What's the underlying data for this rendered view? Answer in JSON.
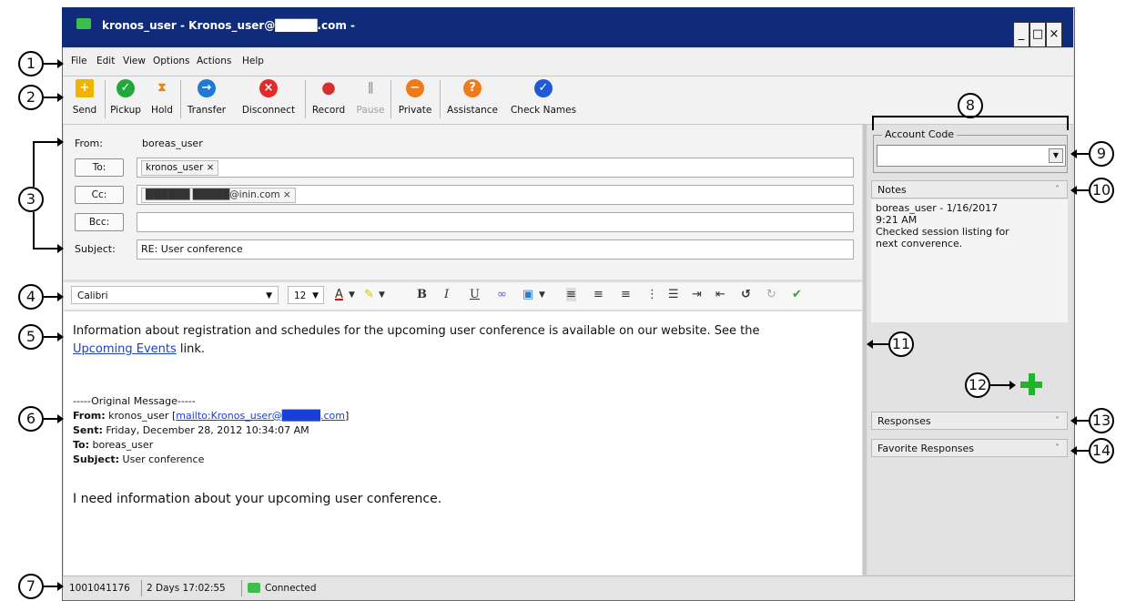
{
  "window": {
    "title": "kronos_user - Kronos_user@█████.com -",
    "min": "_",
    "max": "□",
    "close": "×"
  },
  "menu": [
    "File",
    "Edit",
    "View",
    "Options",
    "Actions",
    "Help"
  ],
  "toolbar": [
    {
      "label": "Send",
      "icon": "send-icon",
      "color": "#f0b400",
      "glyph": "+"
    },
    {
      "label": "Pickup",
      "icon": "pickup-icon",
      "color": "#22a83a",
      "glyph": "✓"
    },
    {
      "label": "Hold",
      "icon": "hold-icon",
      "color": "#e0891a",
      "glyph": "⧗"
    },
    {
      "label": "Transfer",
      "icon": "transfer-icon",
      "color": "#1f7ad6",
      "glyph": "→"
    },
    {
      "label": "Disconnect",
      "icon": "disconnect-icon",
      "color": "#e02b2b",
      "glyph": "×"
    },
    {
      "label": "Record",
      "icon": "record-icon",
      "color": "#d43030",
      "glyph": "●"
    },
    {
      "label": "Pause",
      "icon": "pause-icon",
      "color": "#9a9a9a",
      "glyph": "∥"
    },
    {
      "label": "Private",
      "icon": "private-icon",
      "color": "#ee7a1a",
      "glyph": "−"
    },
    {
      "label": "Assistance",
      "icon": "assistance-icon",
      "color": "#ee7a1a",
      "glyph": "?"
    },
    {
      "label": "Check Names",
      "icon": "check-names-icon",
      "color": "#1f5ad6",
      "glyph": "✓"
    }
  ],
  "header": {
    "from_label": "From:",
    "from_value": "boreas_user",
    "to_button": "To:",
    "to_chip": "kronos_user ×",
    "cc_button": "Cc:",
    "cc_chip": "██████ █████@inin.com ×",
    "bcc_button": "Bcc:",
    "subject_label": "Subject:",
    "subject_value": "RE: User conference"
  },
  "format": {
    "font": "Calibri",
    "size": "12"
  },
  "body": {
    "line1": "Information about registration and schedules for the upcoming user conference is available on our website.  See the",
    "link_text": "Upcoming Events",
    "line2_rest": " link.",
    "orig_header": "-----Original Message-----",
    "from_label": "From:",
    "from_value": " kronos_user [",
    "from_link": "mailto:Kronos_user@█████.com",
    "from_close": "]",
    "sent_label": "Sent:",
    "sent_value": " Friday, December 28, 2012 10:34:07 AM",
    "to_label": "To:",
    "to_value": " boreas_user",
    "subject_label": "Subject:",
    "subject_value": " User conference",
    "closing": "I need information about your upcoming user conference."
  },
  "status": {
    "id": "1001041176",
    "duration": "2 Days 17:02:55",
    "state": "Connected"
  },
  "side": {
    "account_code_label": "Account Code",
    "notes_label": "Notes",
    "notes_lines": [
      "boreas_user - 1/16/2017",
      "9:21 AM",
      "Checked session listing for",
      "next converence."
    ],
    "responses": "Responses",
    "favorite_responses": "Favorite Responses"
  },
  "callouts": [
    "1",
    "2",
    "3",
    "4",
    "5",
    "6",
    "7",
    "8",
    "9",
    "10",
    "11",
    "12",
    "13",
    "14"
  ]
}
